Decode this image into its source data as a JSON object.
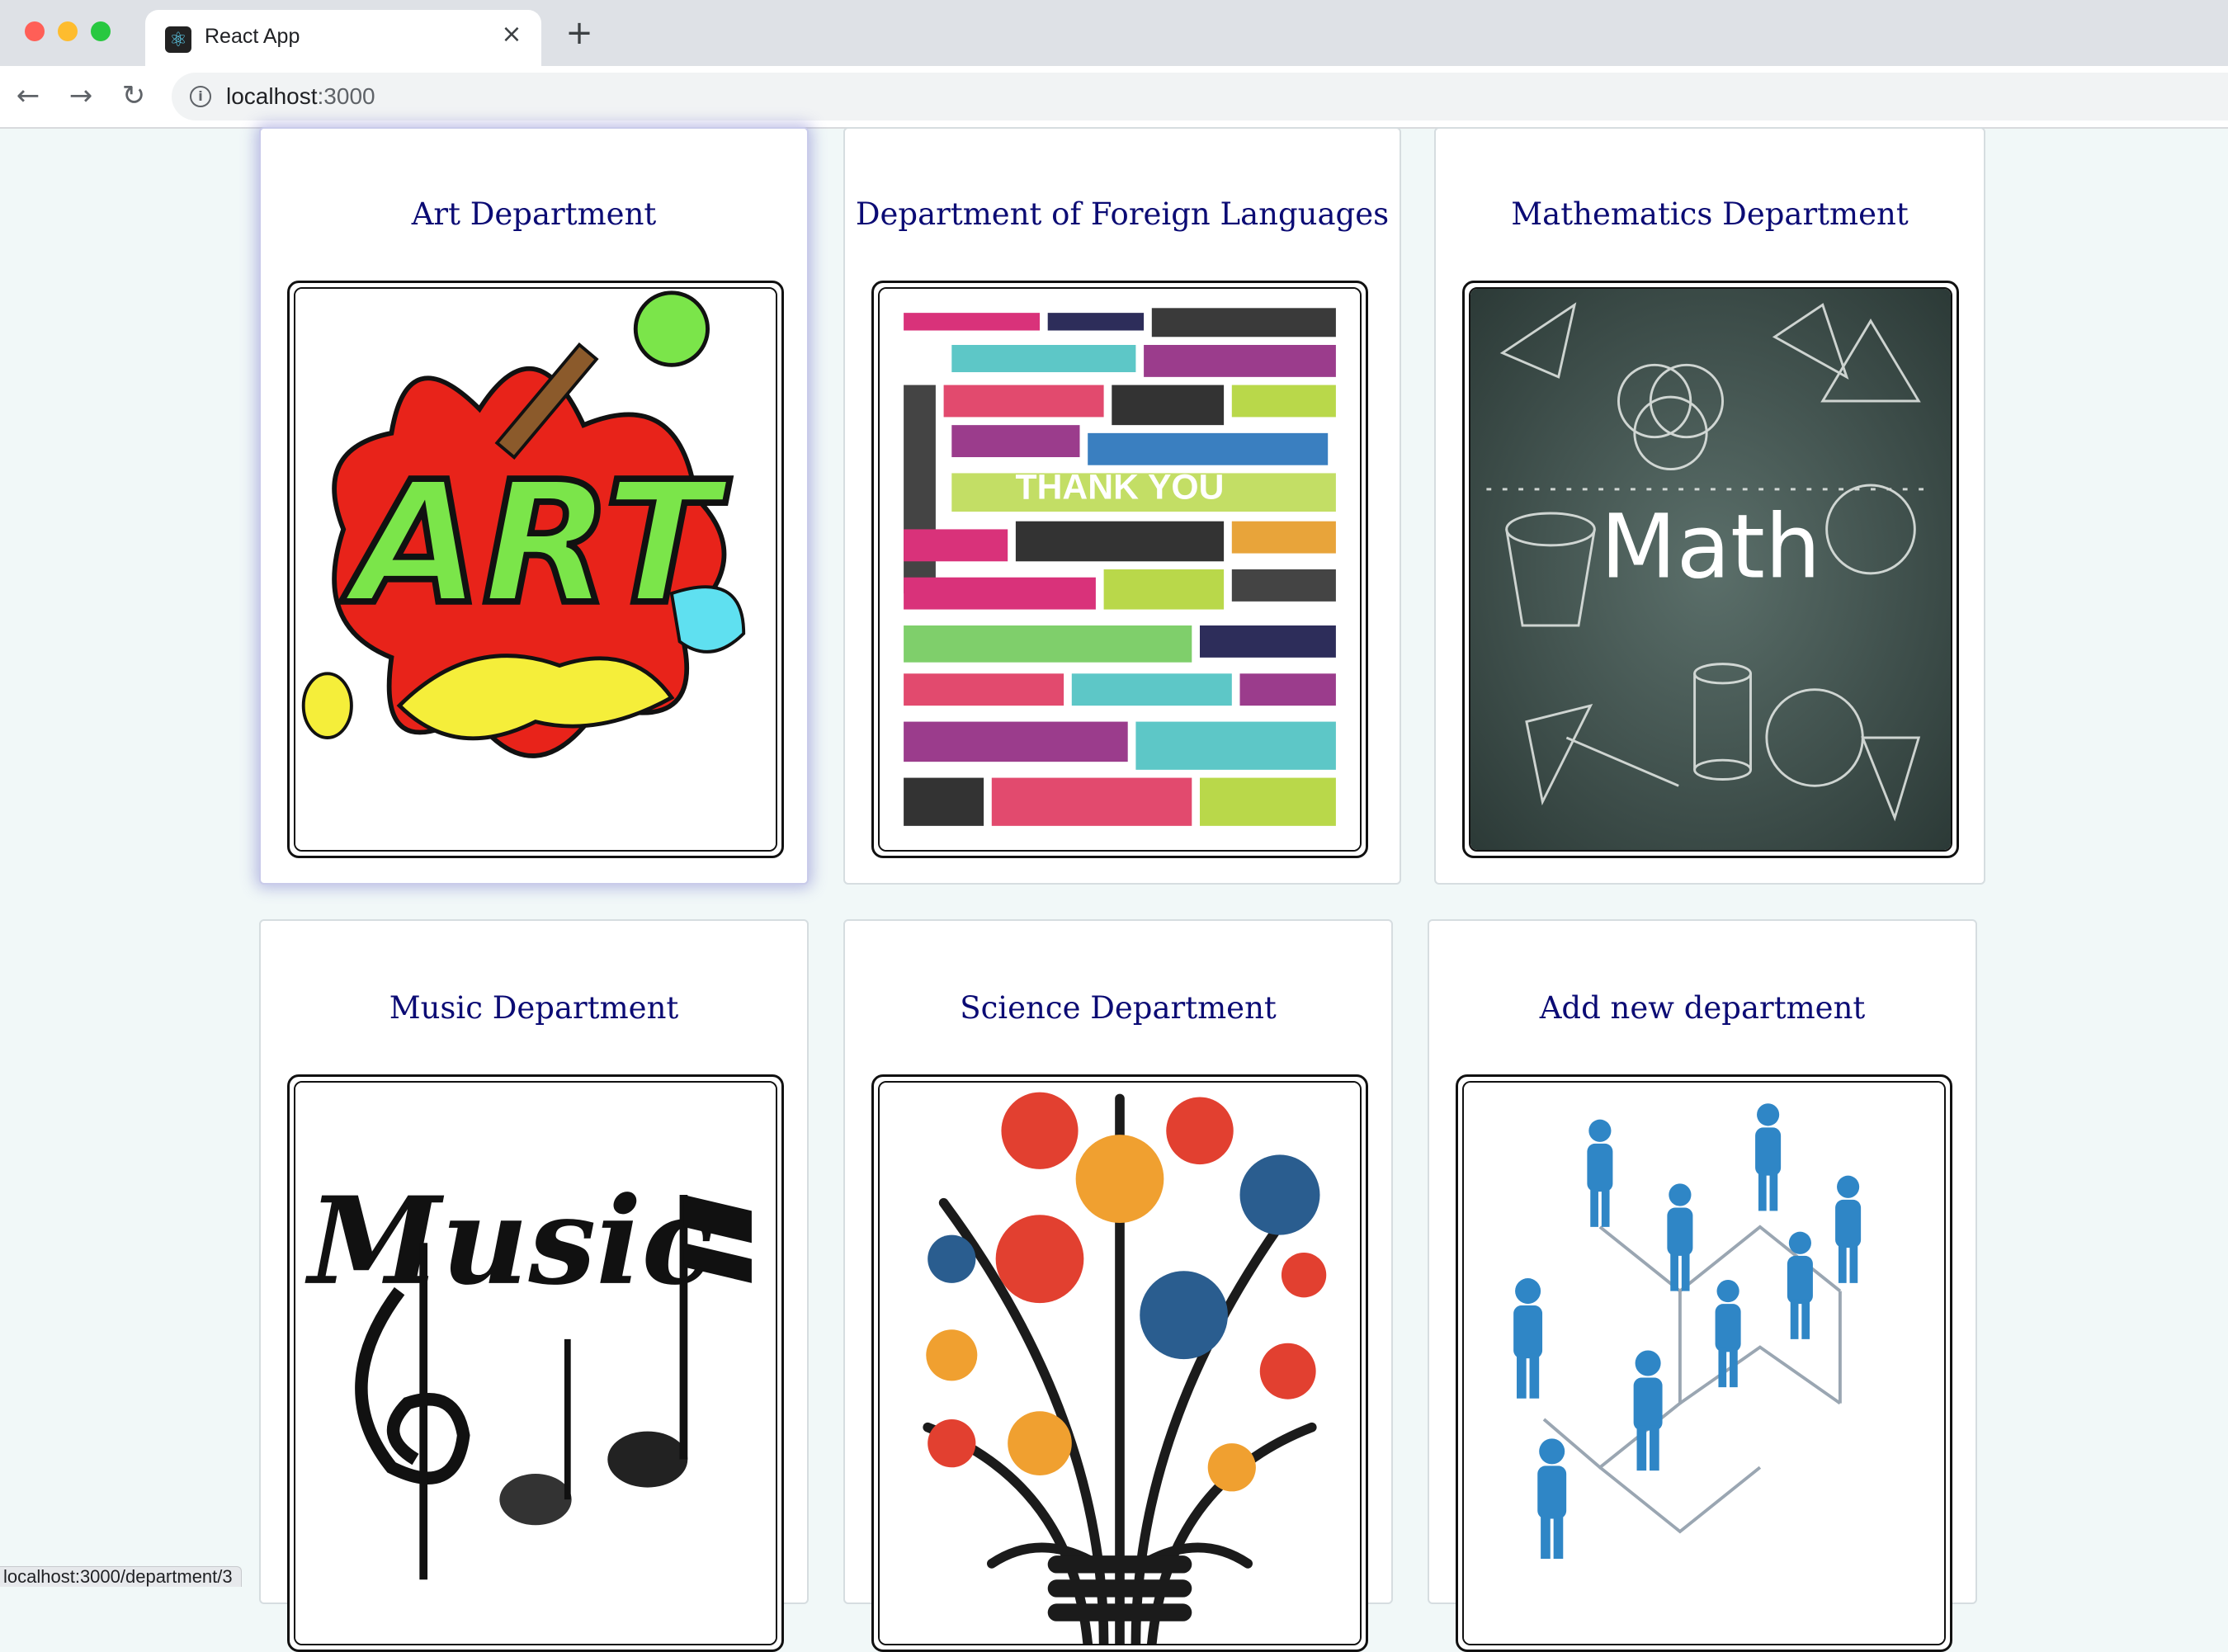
{
  "browser": {
    "tab_title": "React App",
    "new_tab_symbol": "+",
    "close_symbol": "×",
    "url_host": "localhost",
    "url_port": ":3000",
    "status_url": "localhost:3000/department/3"
  },
  "departments": [
    {
      "title": "Art Department",
      "image": "art-image",
      "image_text": "ART"
    },
    {
      "title": "Department of Foreign Languages",
      "image": "foreign-languages-image",
      "image_text": "THANK YOU"
    },
    {
      "title": "Mathematics Department",
      "image": "math-image",
      "image_text": "Math"
    },
    {
      "title": "Music Department",
      "image": "music-image",
      "image_text": "Music"
    },
    {
      "title": "Science Department",
      "image": "science-image"
    },
    {
      "title": "Add new department",
      "image": "org-chart-image"
    }
  ],
  "colors": {
    "page_bg": "#f1f8f8",
    "title_color": "#0b0b74",
    "hover_glow": "#6e6ec8"
  }
}
